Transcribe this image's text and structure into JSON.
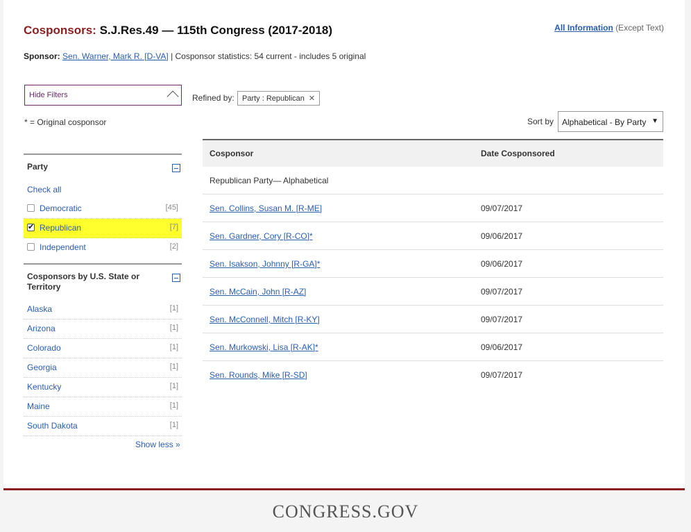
{
  "header": {
    "title_label": "Cosponsors:",
    "title_text": "S.J.Res.49 — 115th Congress (2017-2018)",
    "all_info_link": "All Information",
    "all_info_suffix": "(Except Text)"
  },
  "sponsor": {
    "label": "Sponsor:",
    "name": "Sen. Warner, Mark R. [D-VA]",
    "stats": "| Cosponsor statistics: 54 current - includes 5 original"
  },
  "filters": {
    "hide_label": "Hide Filters",
    "original_note": "* = Original cosponsor",
    "refined_label": "Refined by:",
    "refine_tag": "Party : Republican",
    "refine_tag_close": "✕",
    "party": {
      "heading": "Party",
      "check_all": "Check all",
      "items": [
        {
          "label": "Democratic",
          "count": "[45]"
        },
        {
          "label": "Republican",
          "count": "[7]"
        },
        {
          "label": "Independent",
          "count": "[2]"
        }
      ]
    },
    "state": {
      "heading": "Cosponsors by U.S. State or Territory",
      "items": [
        {
          "label": "Alaska",
          "count": "[1]"
        },
        {
          "label": "Arizona",
          "count": "[1]"
        },
        {
          "label": "Colorado",
          "count": "[1]"
        },
        {
          "label": "Georgia",
          "count": "[1]"
        },
        {
          "label": "Kentucky",
          "count": "[1]"
        },
        {
          "label": "Maine",
          "count": "[1]"
        },
        {
          "label": "South Dakota",
          "count": "[1]"
        }
      ],
      "show_less": "Show less »"
    }
  },
  "sort": {
    "label": "Sort by",
    "selected": "Alphabetical - By Party",
    "arrow": "▼"
  },
  "table": {
    "headers": [
      "Cosponsor",
      "Date Cosponsored"
    ],
    "group_label": "Republican Party— Alphabetical",
    "rows": [
      {
        "name": "Sen. Collins, Susan M. [R-ME]",
        "date": "09/07/2017"
      },
      {
        "name": "Sen. Gardner, Cory [R-CO]*",
        "date": "09/06/2017"
      },
      {
        "name": "Sen. Isakson, Johnny [R-GA]*",
        "date": "09/06/2017"
      },
      {
        "name": "Sen. McCain, John [R-AZ]",
        "date": "09/07/2017"
      },
      {
        "name": "Sen. McConnell, Mitch [R-KY]",
        "date": "09/07/2017"
      },
      {
        "name": "Sen. Murkowski, Lisa [R-AK]*",
        "date": "09/06/2017"
      },
      {
        "name": "Sen. Rounds, Mike [R-SD]",
        "date": "09/07/2017"
      }
    ]
  },
  "footer": {
    "logo": "CONGRESS.GOV"
  }
}
